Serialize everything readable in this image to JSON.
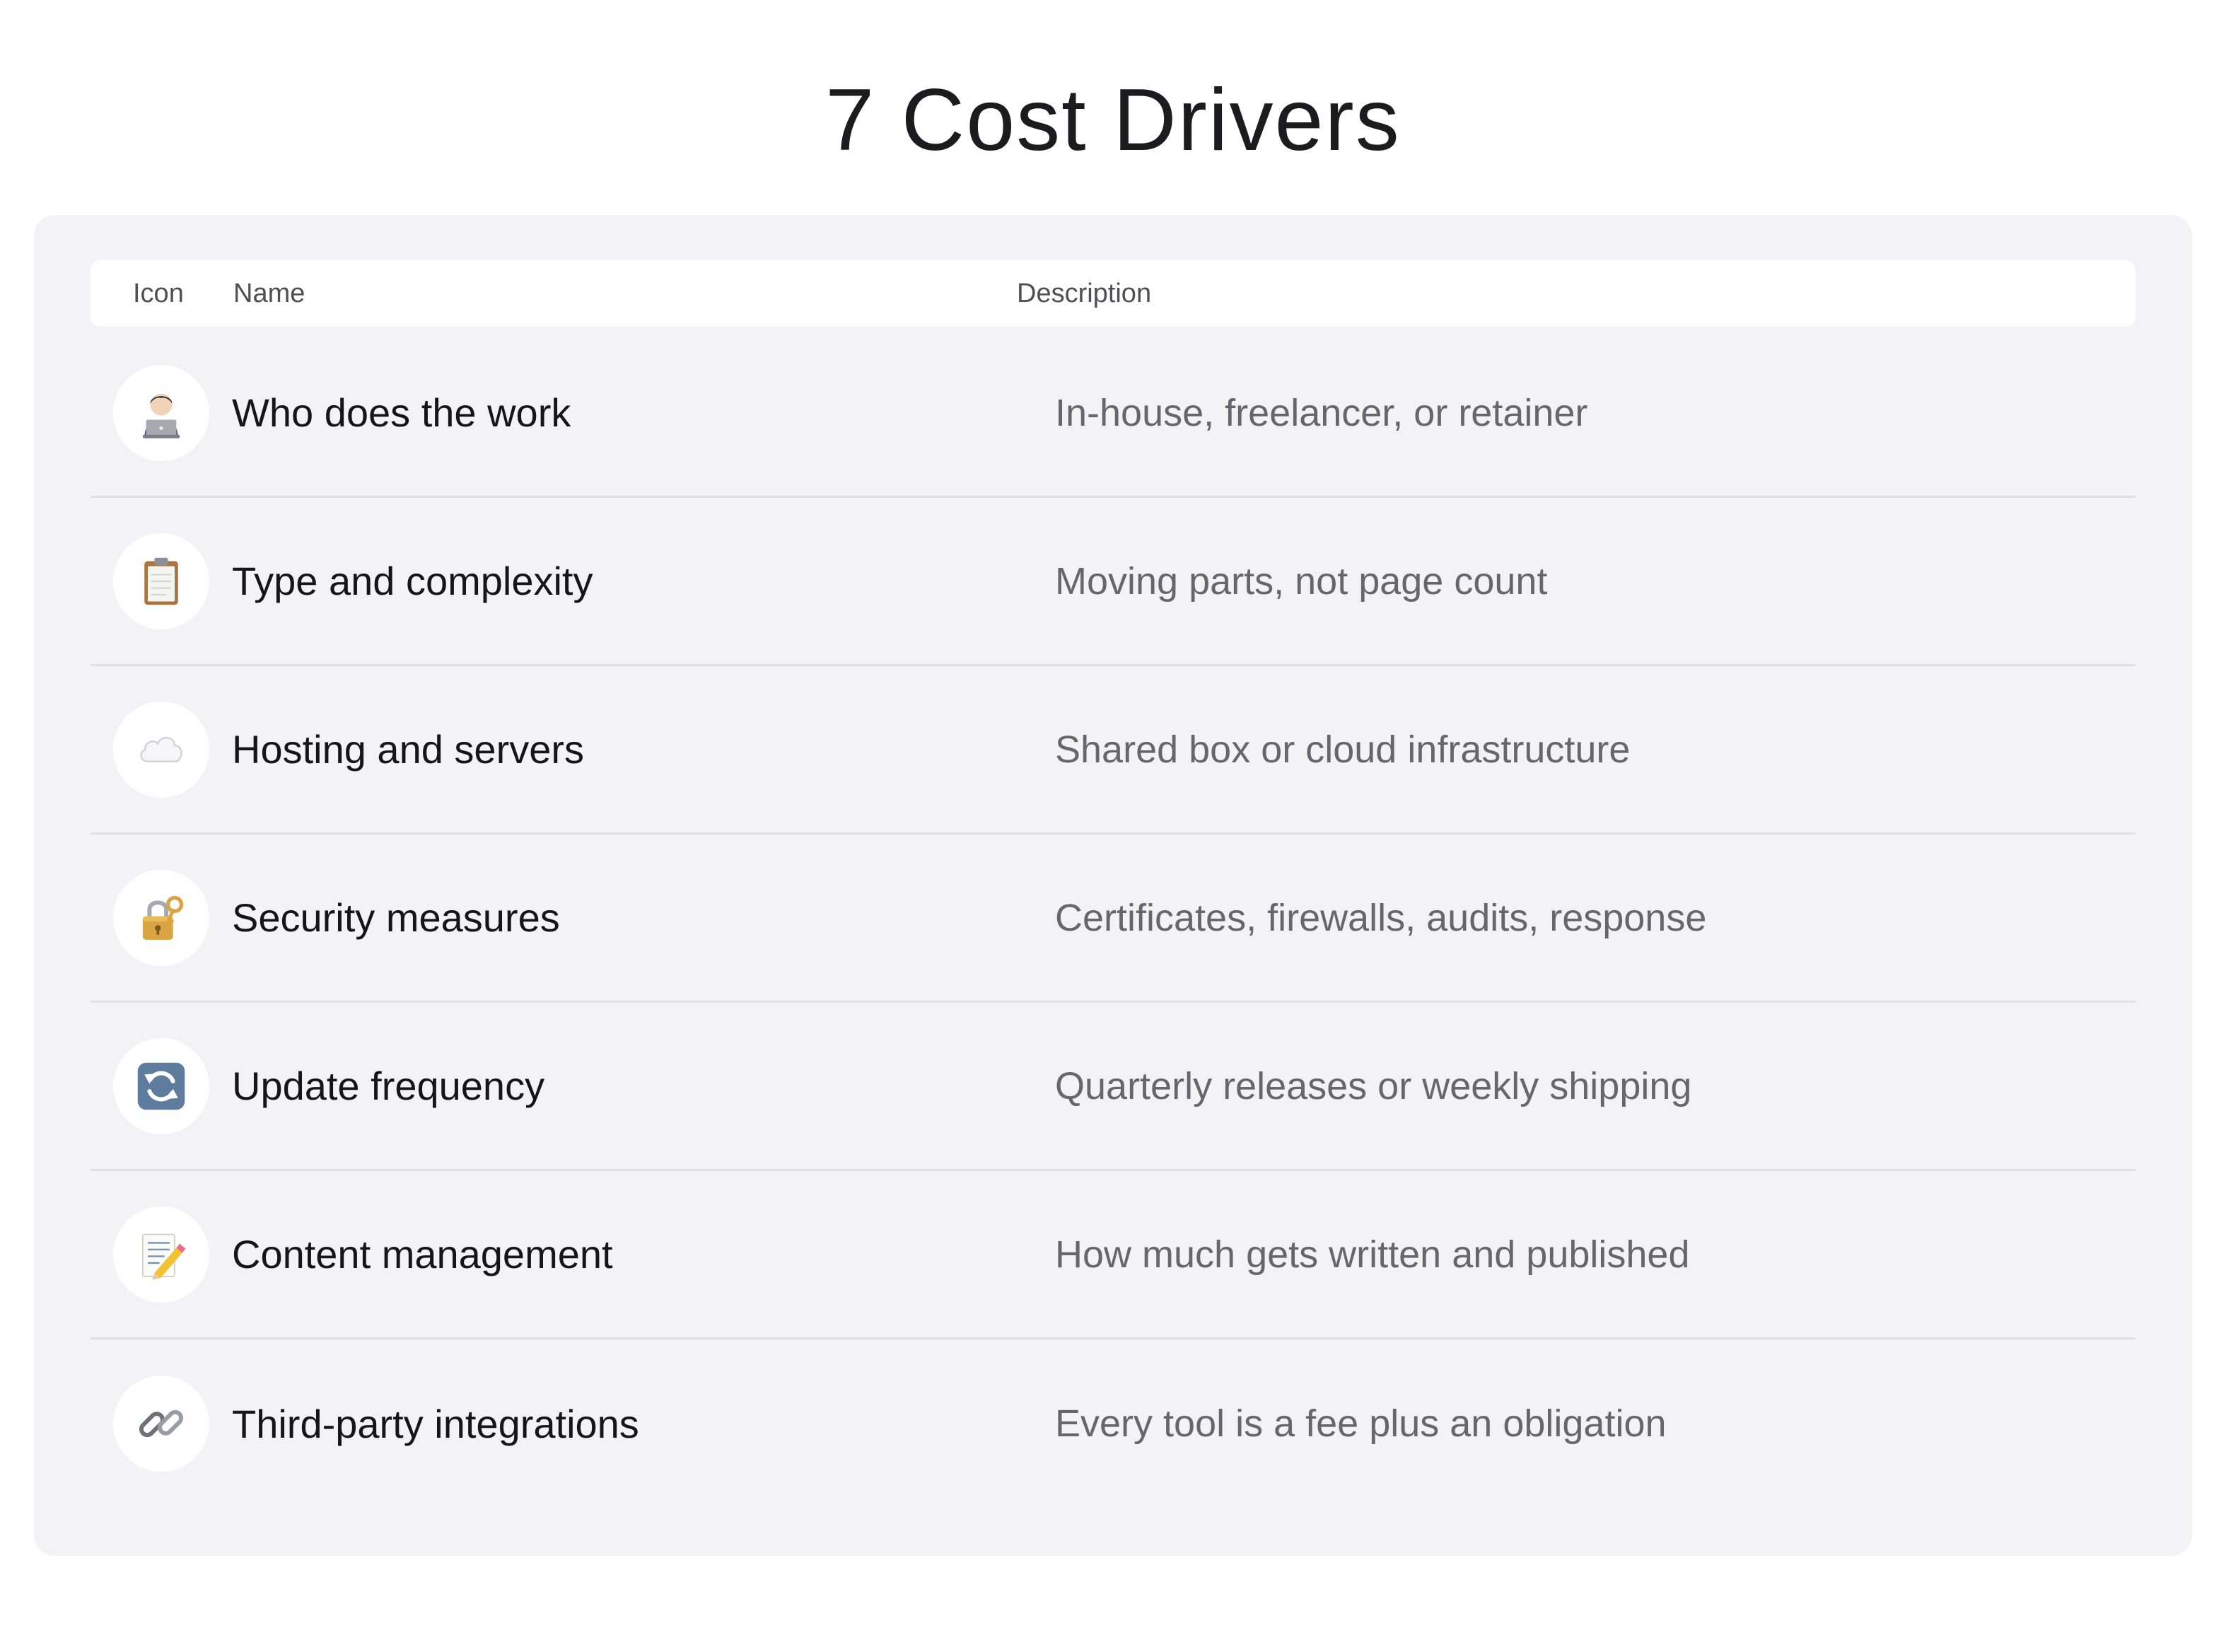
{
  "title": "7 Cost Drivers",
  "table": {
    "headers": {
      "icon": "Icon",
      "name": "Name",
      "description": "Description"
    },
    "rows": [
      {
        "icon": "technologist-icon",
        "name": "Who does the work",
        "description": "In-house, freelancer, or retainer"
      },
      {
        "icon": "clipboard-icon",
        "name": "Type and complexity",
        "description": "Moving parts, not page count"
      },
      {
        "icon": "cloud-icon",
        "name": "Hosting and servers",
        "description": "Shared box or cloud infrastructure"
      },
      {
        "icon": "lock-with-key-icon",
        "name": "Security measures",
        "description": "Certificates, firewalls, audits, response"
      },
      {
        "icon": "refresh-arrows-icon",
        "name": "Update frequency",
        "description": "Quarterly releases or weekly shipping"
      },
      {
        "icon": "memo-pencil-icon",
        "name": "Content management",
        "description": "How much gets written and published"
      },
      {
        "icon": "link-icon",
        "name": "Third-party integrations",
        "description": "Every tool is a fee plus an obligation"
      }
    ]
  },
  "colors": {
    "panel_background": "#f3f3f5",
    "header_background": "#ffffff",
    "title_text": "#1c1c1e",
    "name_text": "#16161a",
    "description_text": "#66666c",
    "divider": "#e1e1e5"
  }
}
